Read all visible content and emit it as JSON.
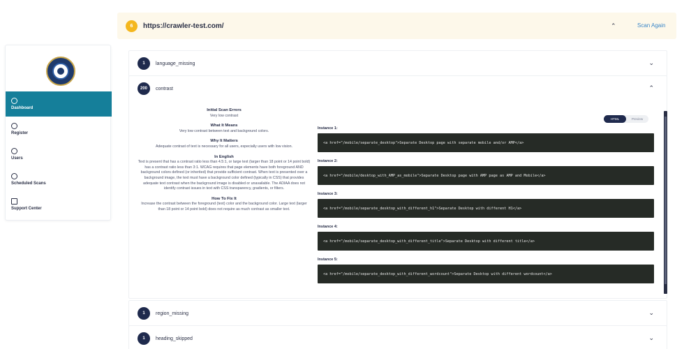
{
  "sidebar": {
    "items": [
      {
        "label": "Dashboard",
        "icon": "wifi-icon"
      },
      {
        "label": "Register",
        "icon": "globe-icon"
      },
      {
        "label": "Users",
        "icon": "user-icon"
      },
      {
        "label": "Scheduled Scans",
        "icon": "clock-icon"
      },
      {
        "label": "Support Center",
        "icon": "support-icon"
      }
    ]
  },
  "site": {
    "badge": "6",
    "url": "https://crawler-test.com/",
    "scan_again": "Scan Again"
  },
  "issues": [
    {
      "count": "1",
      "name": "language_missing"
    },
    {
      "count": "200",
      "name": "contrast"
    },
    {
      "count": "1",
      "name": "region_missing"
    },
    {
      "count": "1",
      "name": "heading_skipped"
    }
  ],
  "contrast": {
    "initial_heading": "Initial Scan Errors",
    "initial_text": "Very low contrast",
    "what_heading": "What It Means",
    "what_text": "Very low contrast between text and background colors.",
    "why_heading": "Why It Matters",
    "why_text": "Adequate contrast of text is necessary for all users, especially users with low vision.",
    "english_heading": "In English",
    "english_text": "Text is present that has a contrast ratio less than 4.5:1, or large text (larger than 18 point or 14 point bold) has a contrast ratio less than 3:1. WCAG requires that page elements have both foreground AND background colors defined (or inherited) that provide sufficient contrast. When text is presented over a background image, the text must have a background color defined (typically in CSS) that provides adequate text contrast when the background image is disabled or unavailable. The ADIAA does not identify contrast issues in text with CSS transparency, gradients, or filters.",
    "fix_heading": "How To Fix It",
    "fix_text": "Increase the contrast between the foreground (text) color and the background color. Large text (larger than 18 point or 14 point bold) does not require as much contrast as smaller text.",
    "toggle_html": "HTML",
    "toggle_preview": "Preview",
    "instances": [
      {
        "label": "Instance 1:",
        "code": "<a href=\"/mobile/separate_desktop\">Separate Desktop page with separate mobile and/or AMP</a>"
      },
      {
        "label": "Instance 2:",
        "code": "<a href=\"/mobile/desktop_with_AMP_as_mobile\">Separate Desktop page with AMP page as AMP and Mobile</a>"
      },
      {
        "label": "Instance 3:",
        "code": "<a href=\"/mobile/separate_desktop_with_different_h1\">Separate Desktop with different H1</a>"
      },
      {
        "label": "Instance 4:",
        "code": "<a href=\"/mobile/separate_desktop_with_different_title\">Separate Desktop with different title</a>"
      },
      {
        "label": "Instance 5:",
        "code": "<a href=\"/mobile/separate_desktop_with_different_wordcount\">Separate Desktop with different wordcount</a>"
      }
    ]
  },
  "colors": {
    "sidebar_active": "#157f9a",
    "badge_dark": "#1f2a4d",
    "site_badge": "#f4b71e",
    "header_bg": "#fdf8ea",
    "code_bg": "#262b26",
    "link": "#3a86c8"
  }
}
